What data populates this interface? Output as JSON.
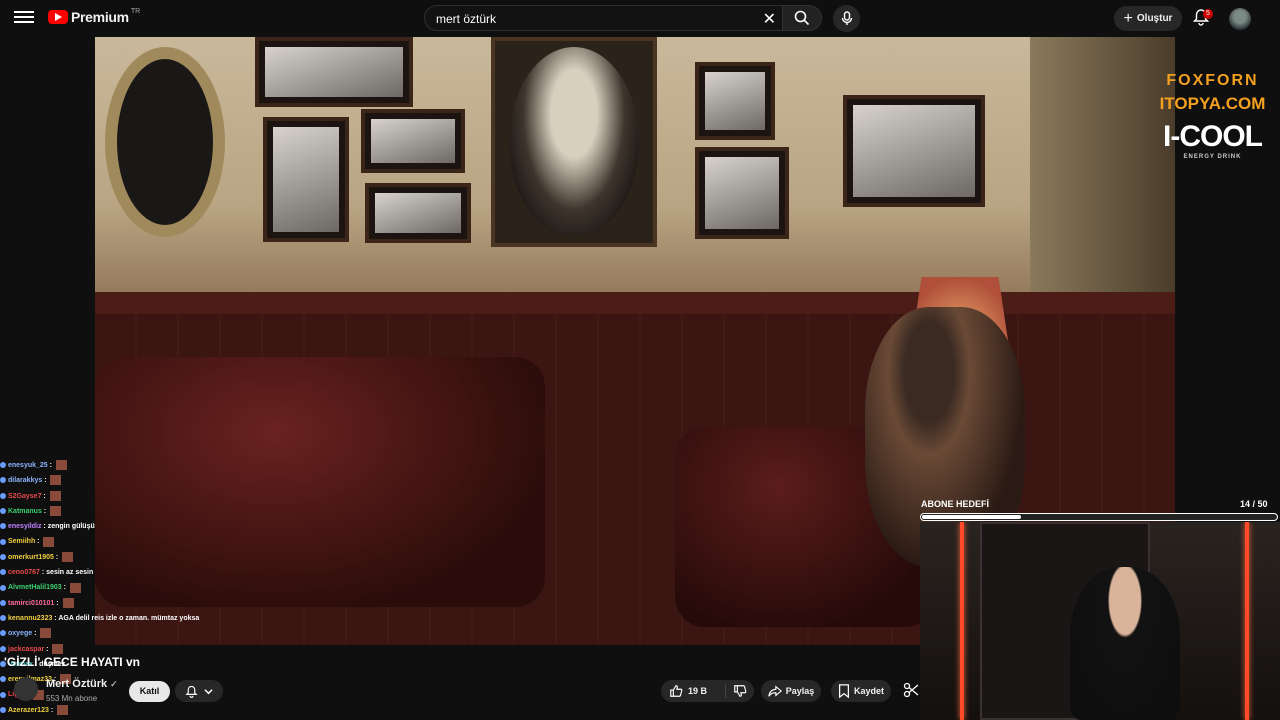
{
  "header": {
    "menu_icon": "hamburger-menu-icon",
    "logo_text": "Premium",
    "logo_country": "TR",
    "search_value": "mert öztürk",
    "create_label": "Oluştur",
    "notification_count": "5"
  },
  "video": {
    "title": "'GİZLİ' GECE HAYATI vn",
    "sponsors": {
      "fox": "FOXFORN",
      "itopya": "ITOPYA.COM",
      "icool": "I-COOL",
      "icool_sub": "ENERGY DRINK"
    }
  },
  "channel": {
    "name": "Mert Öztürk",
    "subscribers": "553 Mn abone",
    "join_label": "Katıl"
  },
  "actions": {
    "like_count": "19 B",
    "share_label": "Paylaş",
    "save_label": "Kaydet"
  },
  "overlay": {
    "goal_label": "ABONE HEDEFİ",
    "goal_count": "14 / 50",
    "goal_fraction": 0.28
  },
  "chat": [
    {
      "user": "enesyuk_25",
      "message": "",
      "color": "cblue"
    },
    {
      "user": "dilarakkys",
      "message": "",
      "color": "cblue"
    },
    {
      "user": "S2Gayse7",
      "message": "",
      "color": "cred"
    },
    {
      "user": "Katmanus",
      "message": "",
      "color": "cgreen"
    },
    {
      "user": "enesyildiz",
      "message": "zengin gülüşü",
      "color": "cpurp"
    },
    {
      "user": "Semiihh",
      "message": "",
      "color": "cyellow"
    },
    {
      "user": "omerkurt1905",
      "message": "",
      "color": "cyellow"
    },
    {
      "user": "ceno0767",
      "message": "sesin az sesin",
      "color": "cred"
    },
    {
      "user": "AlvmetHalil1903",
      "message": "",
      "color": "cgreen"
    },
    {
      "user": "tamirci010101",
      "message": "",
      "color": "cpink"
    },
    {
      "user": "kenannu2323",
      "message": "AGA delil reis izle o zaman. mümtaz yoksa",
      "color": "cyellow"
    },
    {
      "user": "oxyege",
      "message": "",
      "color": "cblue"
    },
    {
      "user": "jackcaspar",
      "message": "",
      "color": "cred"
    },
    {
      "user": "Vermax",
      "message": "düşmez",
      "color": "cteal"
    },
    {
      "user": "erenyilmaz33",
      "message": "",
      "color": "cyellow"
    },
    {
      "user": "Light",
      "message": "",
      "color": "cred"
    },
    {
      "user": "Azerazer123",
      "message": "",
      "color": "cyellow"
    }
  ]
}
